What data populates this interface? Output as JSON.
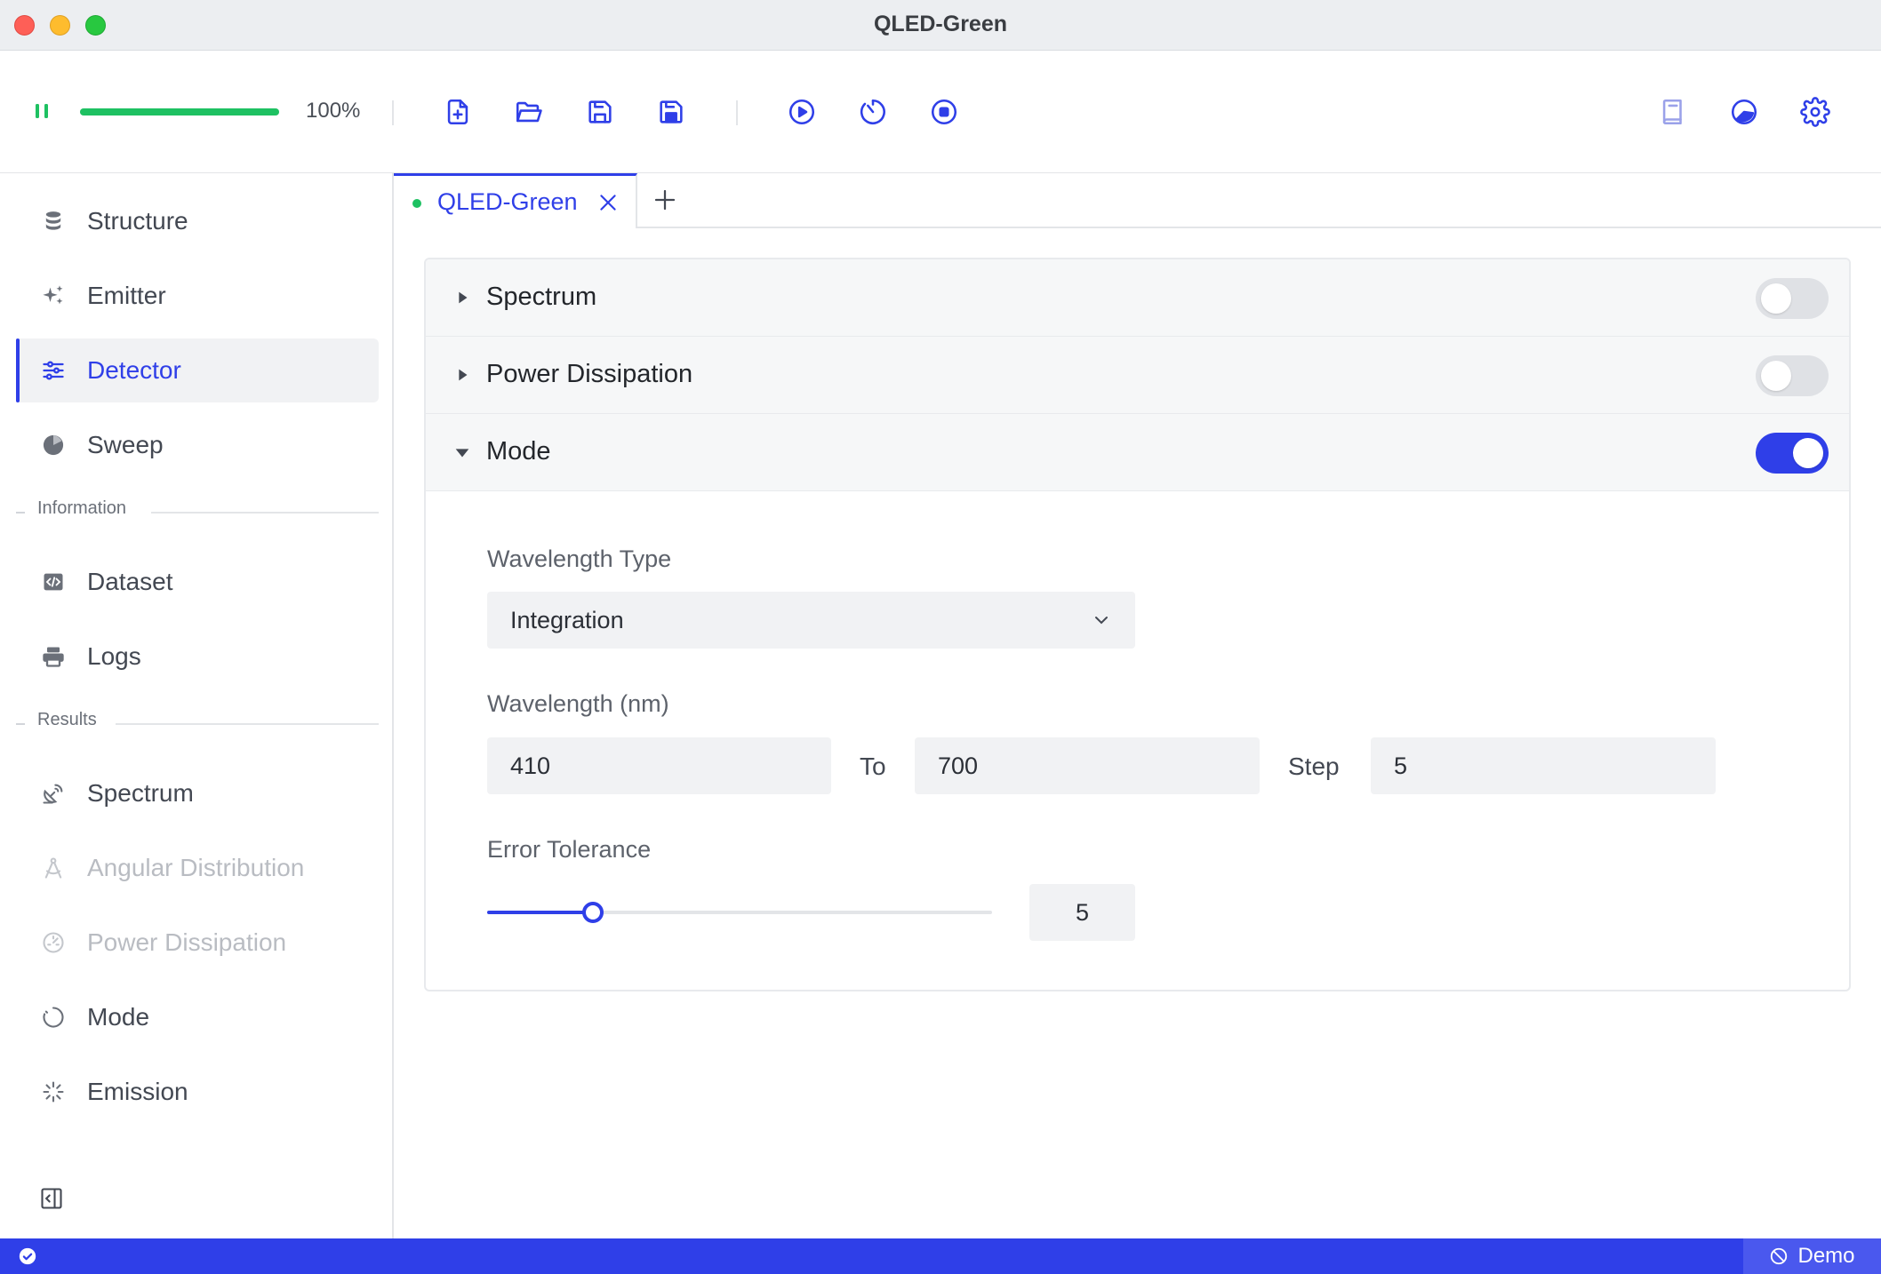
{
  "window": {
    "title": "QLED-Green"
  },
  "toolbar": {
    "progress_value": 1.0,
    "progress_label": "100%",
    "buttons": [
      "new-file",
      "open-folder",
      "save",
      "save-as",
      "run",
      "timer",
      "stop",
      "docs",
      "theme",
      "settings"
    ]
  },
  "sidebar": {
    "items": [
      {
        "label": "Structure",
        "icon": "database-icon"
      },
      {
        "label": "Emitter",
        "icon": "sparkles-icon"
      },
      {
        "label": "Detector",
        "icon": "sliders-icon",
        "active": true
      },
      {
        "label": "Sweep",
        "icon": "pie-icon"
      }
    ],
    "information_header": "Information",
    "information_items": [
      {
        "label": "Dataset",
        "icon": "code-icon"
      },
      {
        "label": "Logs",
        "icon": "printer-icon"
      }
    ],
    "results_header": "Results",
    "results_items": [
      {
        "label": "Spectrum",
        "icon": "satellite-icon"
      },
      {
        "label": "Angular Distribution",
        "icon": "compass-icon",
        "disabled": true
      },
      {
        "label": "Power Dissipation",
        "icon": "gauge-icon",
        "disabled": true
      },
      {
        "label": "Mode",
        "icon": "loader-icon"
      },
      {
        "label": "Emission",
        "icon": "burst-icon"
      }
    ]
  },
  "tabs": [
    {
      "label": "QLED-Green",
      "status": "green"
    }
  ],
  "sections": {
    "spectrum": {
      "title": "Spectrum",
      "enabled": false,
      "expanded": false
    },
    "power": {
      "title": "Power Dissipation",
      "enabled": false,
      "expanded": false
    },
    "mode": {
      "title": "Mode",
      "enabled": true,
      "expanded": true,
      "wavelength_type_label": "Wavelength Type",
      "wavelength_type_value": "Integration",
      "wavelength_label": "Wavelength (nm)",
      "wavelength_from": "410",
      "to_label": "To",
      "wavelength_to": "700",
      "step_label": "Step",
      "wavelength_step": "5",
      "error_tolerance_label": "Error Tolerance",
      "error_tolerance_value": "5",
      "error_tolerance_fraction": 0.21
    }
  },
  "statusbar": {
    "badge": "Demo"
  },
  "colors": {
    "accent": "#2f3fe8",
    "success": "#1ec162"
  }
}
